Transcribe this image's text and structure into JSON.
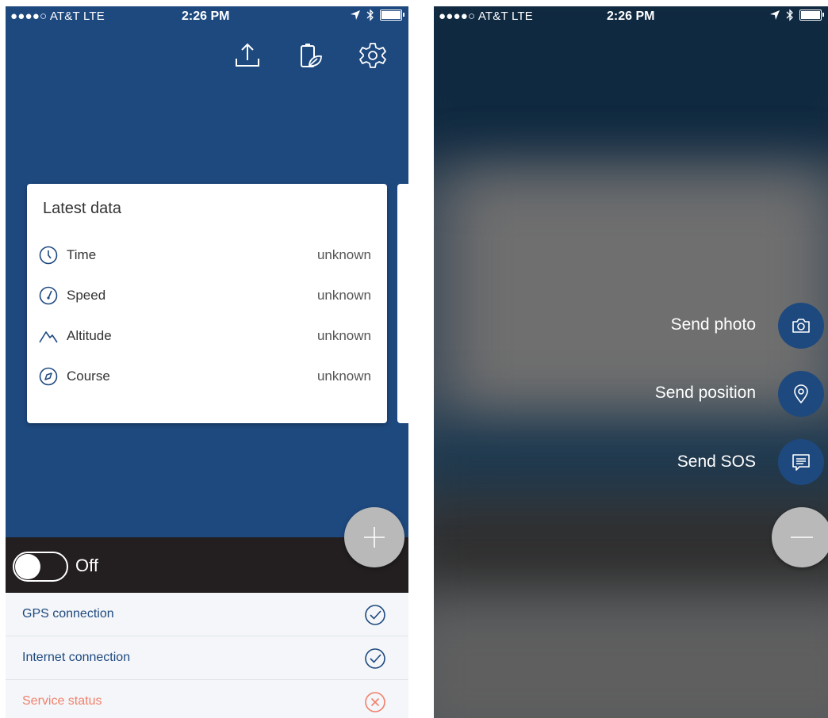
{
  "status_bar": {
    "carrier": "●●●●○ AT&T  LTE",
    "time": "2:26 PM"
  },
  "toolbar": {
    "icons": [
      "upload-icon",
      "battery-leaf-icon",
      "gear-icon"
    ]
  },
  "latest_data": {
    "title": "Latest data",
    "rows": [
      {
        "icon": "clock-icon",
        "label": "Time",
        "value": "unknown"
      },
      {
        "icon": "speedometer-icon",
        "label": "Speed",
        "value": "unknown"
      },
      {
        "icon": "mountain-icon",
        "label": "Altitude",
        "value": "unknown"
      },
      {
        "icon": "compass-icon",
        "label": "Course",
        "value": "unknown"
      }
    ]
  },
  "tracking_toggle": {
    "state_label": "Off"
  },
  "status_list": [
    {
      "label": "GPS connection",
      "state": "ok",
      "color": "#1e497f"
    },
    {
      "label": "Internet connection",
      "state": "ok",
      "color": "#1e497f"
    },
    {
      "label": "Service status",
      "state": "error",
      "color": "#f1806b"
    }
  ],
  "fab_menu": {
    "actions": [
      {
        "label": "Send photo",
        "icon": "camera-icon"
      },
      {
        "label": "Send position",
        "icon": "location-pin-icon"
      },
      {
        "label": "Send SOS",
        "icon": "chat-message-icon"
      }
    ]
  },
  "colors": {
    "primary": "#1e497f",
    "dark_bar": "#231f20",
    "ok": "#1e497f",
    "error": "#f1806b",
    "fab": "#b9b9b9"
  }
}
